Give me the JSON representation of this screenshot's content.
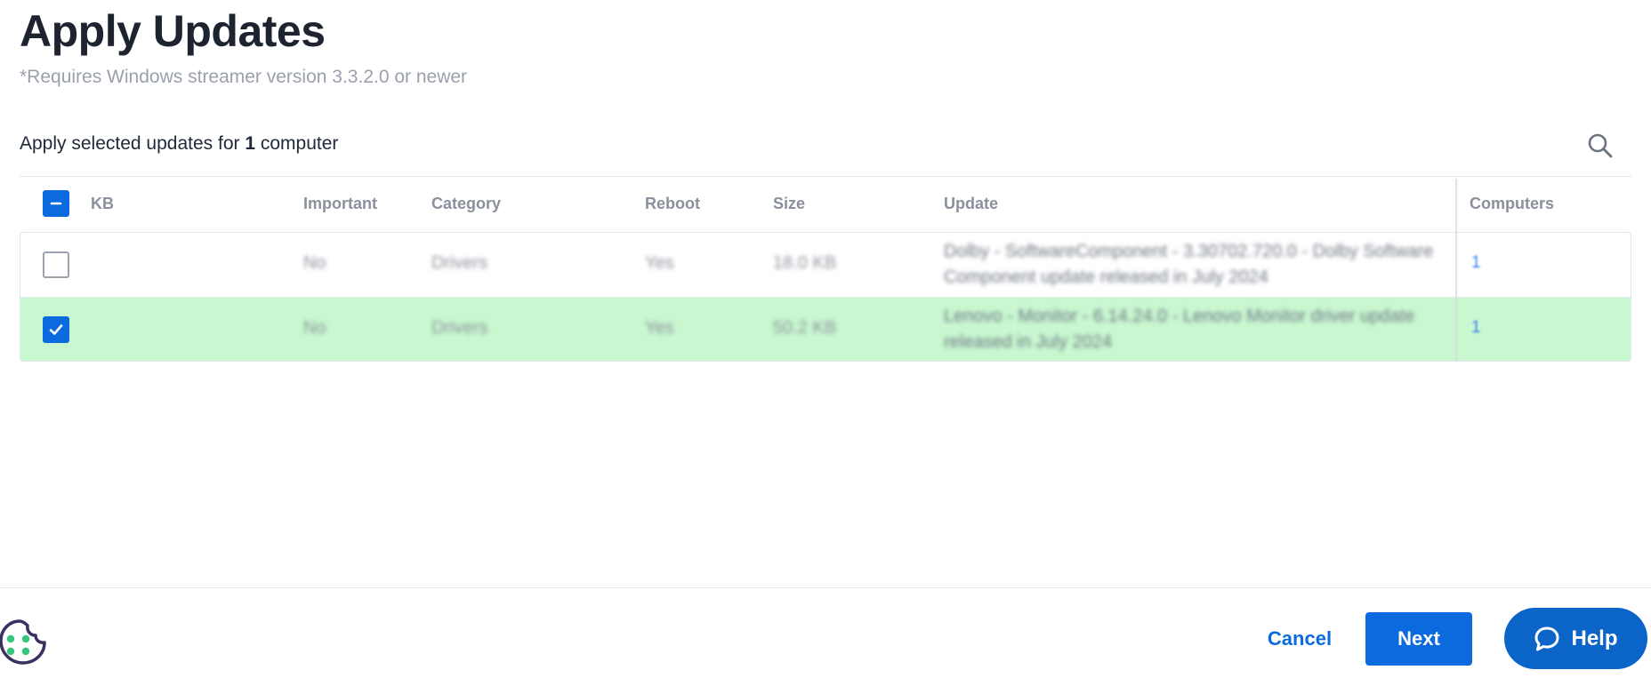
{
  "header": {
    "title": "Apply Updates",
    "subtitle": "*Requires Windows streamer version 3.3.2.0 or newer"
  },
  "summary": {
    "prefix": "Apply selected updates for ",
    "count": "1",
    "suffix": " computer"
  },
  "table": {
    "columns": {
      "kb": "KB",
      "important": "Important",
      "category": "Category",
      "reboot": "Reboot",
      "size": "Size",
      "update": "Update",
      "computers": "Computers"
    },
    "rows": [
      {
        "selected": false,
        "kb": "",
        "important": "No",
        "category": "Drivers",
        "reboot": "Yes",
        "size": "18.0 KB",
        "update": "Dolby - SoftwareComponent - 3.30702.720.0 - Dolby Software Component update released in July 2024",
        "computers": "1"
      },
      {
        "selected": true,
        "kb": "",
        "important": "No",
        "category": "Drivers",
        "reboot": "Yes",
        "size": "50.2 KB",
        "update": "Lenovo - Monitor - 6.14.24.0 - Lenovo Monitor driver update released in July 2024",
        "computers": "1"
      }
    ]
  },
  "footer": {
    "cancel_label": "Cancel",
    "next_label": "Next",
    "help_label": "Help"
  },
  "colors": {
    "accent": "#0b6bde",
    "selected_row": "#c8f7d0",
    "help": "#0b64c8",
    "cookie_outline": "#3b2f63",
    "cookie_dots": "#34c77b"
  },
  "icons": {
    "search": "search-icon",
    "select_all": "minus-icon",
    "checkmark": "check-icon",
    "cookie": "cookie-icon",
    "help": "chat-bubble-icon"
  }
}
